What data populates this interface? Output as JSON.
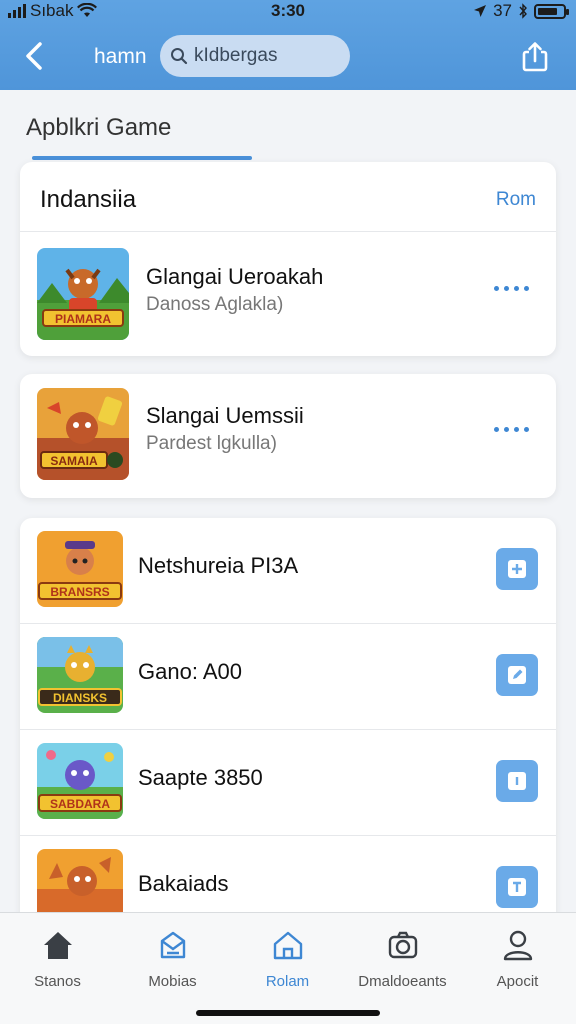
{
  "status_bar": {
    "carrier": "Sıbak",
    "time": "3:30",
    "battery": "37"
  },
  "nav": {
    "back_icon": "chevron-left-icon",
    "title": "hamn",
    "search_placeholder": "kIdbergas",
    "share_icon": "share-icon"
  },
  "section": {
    "title": "Apblkri Game"
  },
  "featured": {
    "heading": "Indansiia",
    "link": "Rom",
    "items": [
      {
        "title": "Glangai Ueroakah",
        "subtitle": "Danoss Aglakla)",
        "badge": "PIAMARA"
      },
      {
        "title": "Slangai Uemssii",
        "subtitle": "Pardest lgkulla)",
        "badge": "SAMAIA"
      }
    ]
  },
  "games": [
    {
      "title": "Netshureia PI3A",
      "badge": "BRANSRS",
      "action_icon": "plus-icon"
    },
    {
      "title": "Gano: A00",
      "badge": "DIANSKS",
      "action_icon": "edit-icon"
    },
    {
      "title": "Saapte 3850",
      "badge": "SABDARA",
      "action_icon": "info-icon"
    },
    {
      "title": "Bakaiads",
      "badge": "",
      "action_icon": "download-icon"
    }
  ],
  "tabs": [
    {
      "label": "Stanos",
      "icon": "home-icon"
    },
    {
      "label": "Mobias",
      "icon": "inbox-icon"
    },
    {
      "label": "Rolam",
      "icon": "house-outline-icon"
    },
    {
      "label": "Dmaldoeants",
      "icon": "camera-icon"
    },
    {
      "label": "Apocit",
      "icon": "user-icon"
    }
  ],
  "colors": {
    "accent": "#3e87d3",
    "header": "#5a9fe0",
    "button": "#6aaae8"
  }
}
